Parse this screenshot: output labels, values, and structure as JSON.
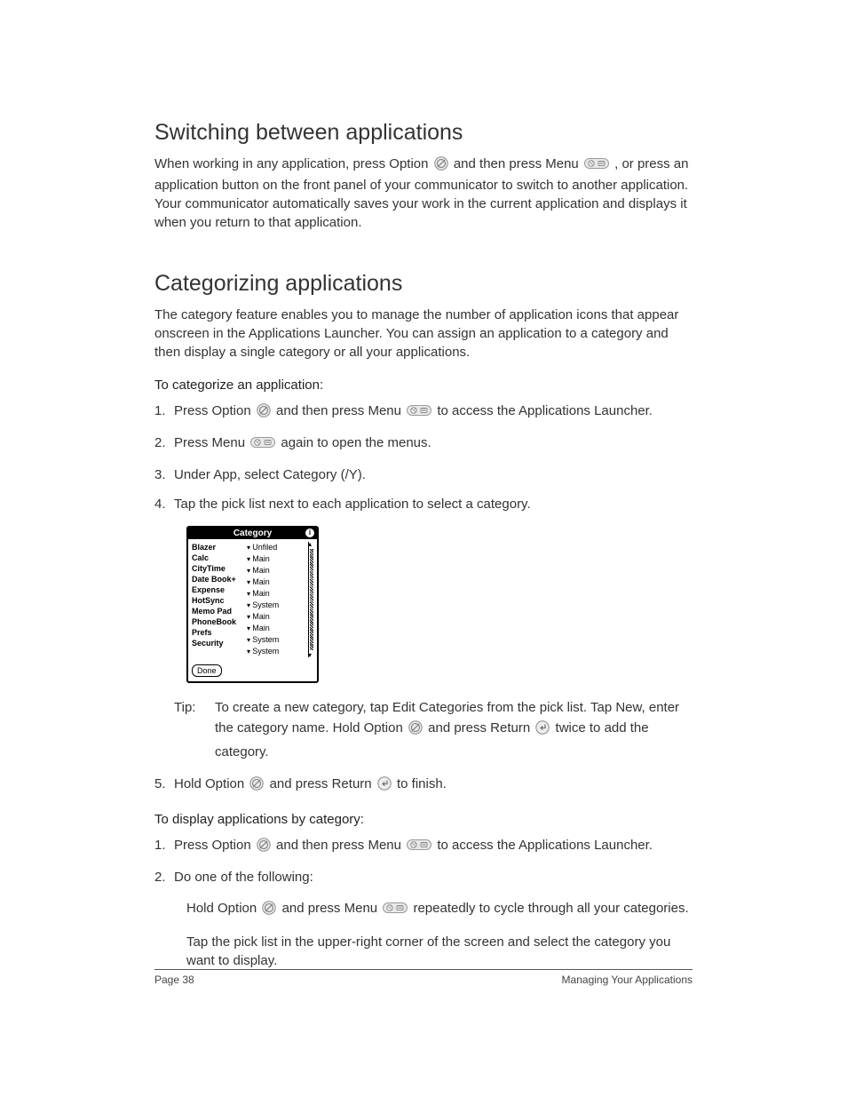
{
  "section1": {
    "heading": "Switching between applications",
    "body_parts": [
      "When working in any application, press Option ",
      " and then press Menu ",
      ", or press an application button on the front panel of your communicator to switch to another application. Your communicator automatically saves your work in the current application and displays it when you return to that application."
    ]
  },
  "section2": {
    "heading": "Categorizing applications",
    "body": "The category feature enables you to manage the number of application icons that appear onscreen in the Applications Launcher. You can assign an application to a category and then display a single category or all your applications.",
    "sub1_heading": "To categorize an application:",
    "steps1": {
      "s1": {
        "a": "Press Option ",
        "b": " and then press Menu ",
        "c": " to access the Applications Launcher."
      },
      "s2": {
        "a": "Press Menu ",
        "b": " again to open the menus."
      },
      "s3": "Under App, select Category (/Y).",
      "s4": "Tap the pick list next to each application to select a category.",
      "s5": {
        "a": "Hold Option ",
        "b": " and press Return ",
        "c": " to finish."
      }
    },
    "tip": {
      "label": "Tip:",
      "a": "To create a new category, tap Edit Categories from the pick list. Tap New, enter the category name. Hold Option ",
      "b": " and press Return ",
      "c": " twice to add the category."
    },
    "sub2_heading": "To display applications by category:",
    "steps2": {
      "s1": {
        "a": "Press Option ",
        "b": " and then press Menu ",
        "c": " to access the Applications Launcher."
      },
      "s2": "Do one of the following:"
    },
    "sub_options": {
      "o1": {
        "a": "Hold Option ",
        "b": " and press Menu ",
        "c": " repeatedly to cycle through all your categories."
      },
      "o2": "Tap the pick list in the upper-right corner of the screen and select the category you want to display."
    }
  },
  "category_window": {
    "title": "Category",
    "apps": [
      "Blazer",
      "Calc",
      "CityTime",
      "Date Book+",
      "Expense",
      "HotSync",
      "Memo Pad",
      "PhoneBook",
      "Prefs",
      "Security"
    ],
    "cats": [
      "Unfiled",
      "Main",
      "Main",
      "Main",
      "Main",
      "System",
      "Main",
      "Main",
      "System",
      "System"
    ],
    "done": "Done"
  },
  "footer": {
    "left": "Page 38",
    "right": "Managing Your Applications"
  }
}
